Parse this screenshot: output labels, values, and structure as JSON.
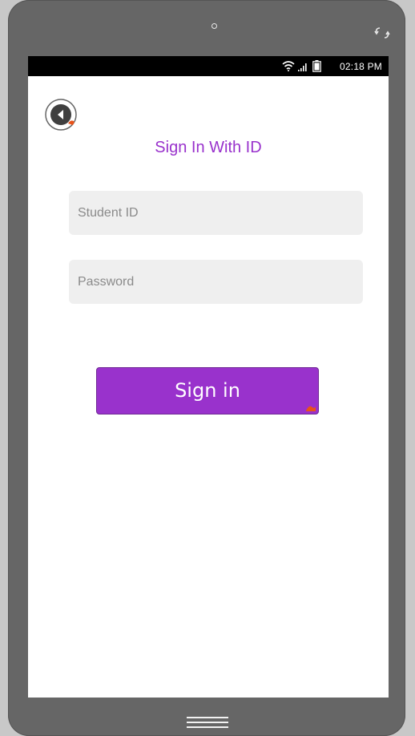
{
  "status_bar": {
    "time": "02:18 PM",
    "icons": [
      "wifi-icon",
      "signal-icon",
      "battery-icon"
    ]
  },
  "header": {
    "back_icon": "back-arrow-icon",
    "title": "Sign In With ID"
  },
  "form": {
    "student_id": {
      "placeholder": "Student ID",
      "value": ""
    },
    "password": {
      "placeholder": "Password",
      "value": ""
    },
    "submit_label": "Sign in"
  },
  "device": {
    "top_icon": "rotate-icon",
    "bottom_icon": "home-menu-icon"
  },
  "colors": {
    "accent": "#9932cc",
    "field_bg": "#efefef",
    "frame": "#666666",
    "status_bar": "#000000"
  }
}
